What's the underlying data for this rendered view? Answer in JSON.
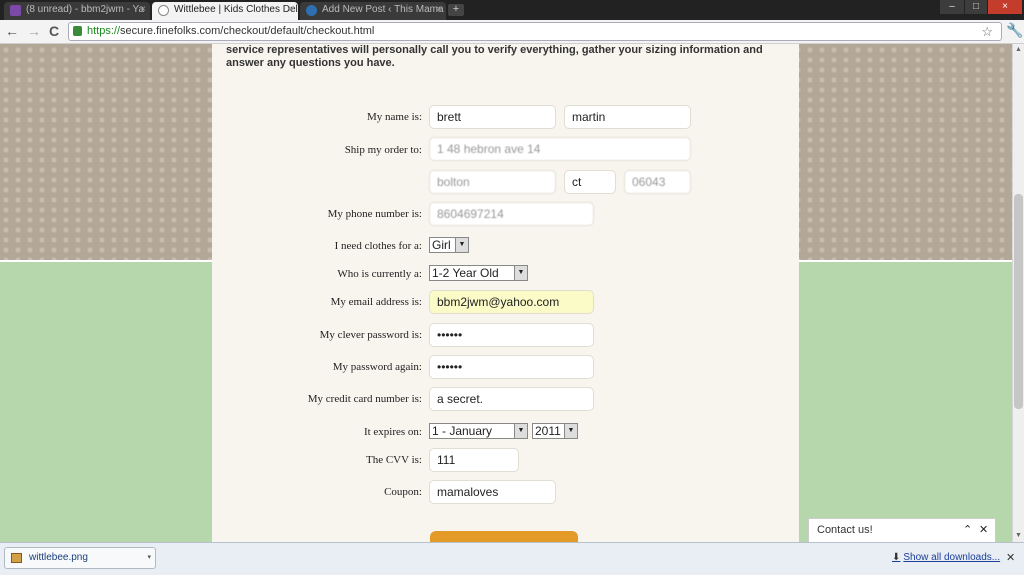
{
  "browser": {
    "tabs": [
      {
        "title": "(8 unread) - bbm2jwm - Ya",
        "active": false,
        "favicon_color": "#7b4aa8"
      },
      {
        "title": "Wittlebee | Kids Clothes Del",
        "active": true,
        "favicon_color": "#888888"
      },
      {
        "title": "Add New Post ‹ This Mama",
        "active": false,
        "favicon_color": "#2d6fb0"
      }
    ],
    "tab_close": "×",
    "new_tab": "+",
    "window_controls": {
      "minimize": "–",
      "maximize": "□",
      "close": "×"
    },
    "nav": {
      "back": "←",
      "forward": "→",
      "reload": "C"
    },
    "url_scheme": "https://",
    "url_rest": "secure.finefolks.com/checkout/default/checkout.html",
    "bookmark_star": "☆",
    "wrench": "🔧"
  },
  "page": {
    "intro_line1": "service representatives will personally call you to verify everything, gather your sizing information and",
    "intro_line2": "answer any questions you have.",
    "form": {
      "name_label": "My name is:",
      "first_name": "brett",
      "last_name": "martin",
      "ship_label": "Ship my order to:",
      "address": "1 48 hebron ave 14",
      "city": "bolton",
      "state": "ct",
      "zip": "06043",
      "phone_label": "My phone number is:",
      "phone": "8604697214",
      "clothes_for_label": "I need clothes for a:",
      "clothes_for_value": "Girl",
      "age_label": "Who is currently a:",
      "age_value": "1-2 Year Old",
      "email_label": "My email address is:",
      "email": "bbm2jwm@yahoo.com",
      "password_label": "My clever password is:",
      "password": "••••••",
      "password_again_label": "My password again:",
      "password_again": "••••••",
      "card_label": "My credit card number is:",
      "card": "a secret.",
      "expires_label": "It expires on:",
      "expires_month": "1 - January",
      "expires_year": "2011",
      "cvv_label": "The CVV is:",
      "cvv": "111",
      "coupon_label": "Coupon:",
      "coupon": "mamaloves"
    },
    "select_arrow": "▼"
  },
  "contact_widget": {
    "label": "Contact us!",
    "collapse": "⌃",
    "close": "✕"
  },
  "downloads": {
    "file": "wittlebee.png",
    "menu_arrow": "▾",
    "show_all": "Show all downloads...",
    "show_all_icon": "⬇",
    "close": "✕"
  },
  "scrollbar": {
    "up": "▲",
    "down": "▼"
  },
  "colors": {
    "accent_orange": "#e39a26",
    "background_tan": "#b3a898",
    "background_green": "#b6d6ab",
    "email_highlight": "#fbfbc8"
  }
}
